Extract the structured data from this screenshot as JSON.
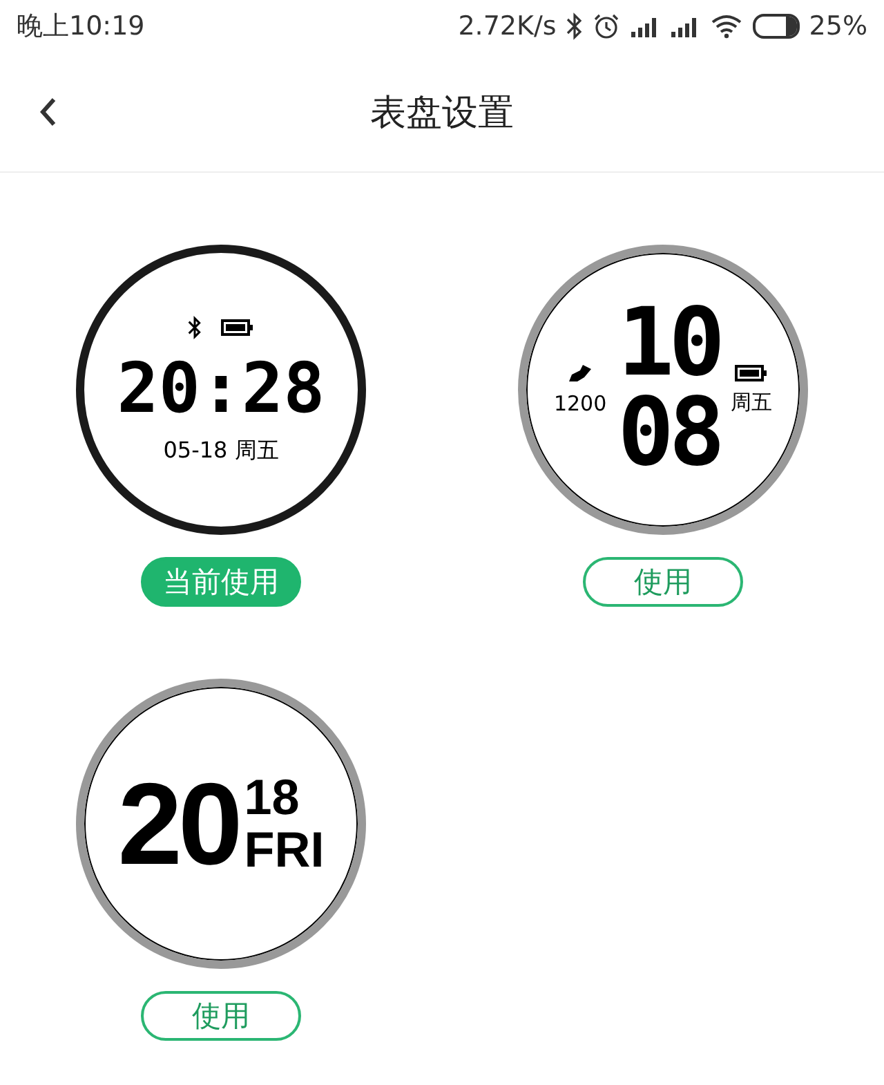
{
  "status_bar": {
    "time": "晚上10:19",
    "speed": "2.72K/s",
    "battery": "25%"
  },
  "header": {
    "title": "表盘设置"
  },
  "faces": [
    {
      "kind": "digital",
      "selected": true,
      "button": "当前使用",
      "time": "20:28",
      "date": "05-18 周五"
    },
    {
      "kind": "vertical",
      "selected": false,
      "button": "使用",
      "hour": "10",
      "minute": "08",
      "steps": "1200",
      "weekday": "周五"
    },
    {
      "kind": "date",
      "selected": false,
      "button": "使用",
      "big": "20",
      "small": "18",
      "weekday": "FRI"
    }
  ]
}
